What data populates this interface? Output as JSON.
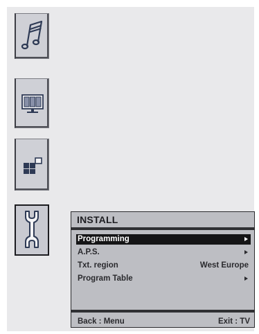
{
  "sidebar": {
    "items": [
      {
        "name": "sound",
        "icon": "music-note-icon"
      },
      {
        "name": "picture",
        "icon": "picture-monitor-icon"
      },
      {
        "name": "feature",
        "icon": "feature-blocks-icon"
      },
      {
        "name": "install",
        "icon": "wrench-icon",
        "selected": true
      }
    ]
  },
  "menu": {
    "title": "INSTALL",
    "items": [
      {
        "label": "Programming",
        "value": "",
        "arrow": true,
        "selected": true
      },
      {
        "label": "A.P.S.",
        "value": "",
        "arrow": true,
        "selected": false
      },
      {
        "label": "Txt. region",
        "value": "West Europe",
        "arrow": false,
        "selected": false
      },
      {
        "label": "Program Table",
        "value": "",
        "arrow": true,
        "selected": false
      }
    ],
    "footer": {
      "back": "Back : Menu",
      "exit": "Exit : TV"
    }
  },
  "colors": {
    "background": "#e9e9eb",
    "panel": "#bdbec3",
    "selected_row": "#151516",
    "bar": "#2f3033"
  }
}
